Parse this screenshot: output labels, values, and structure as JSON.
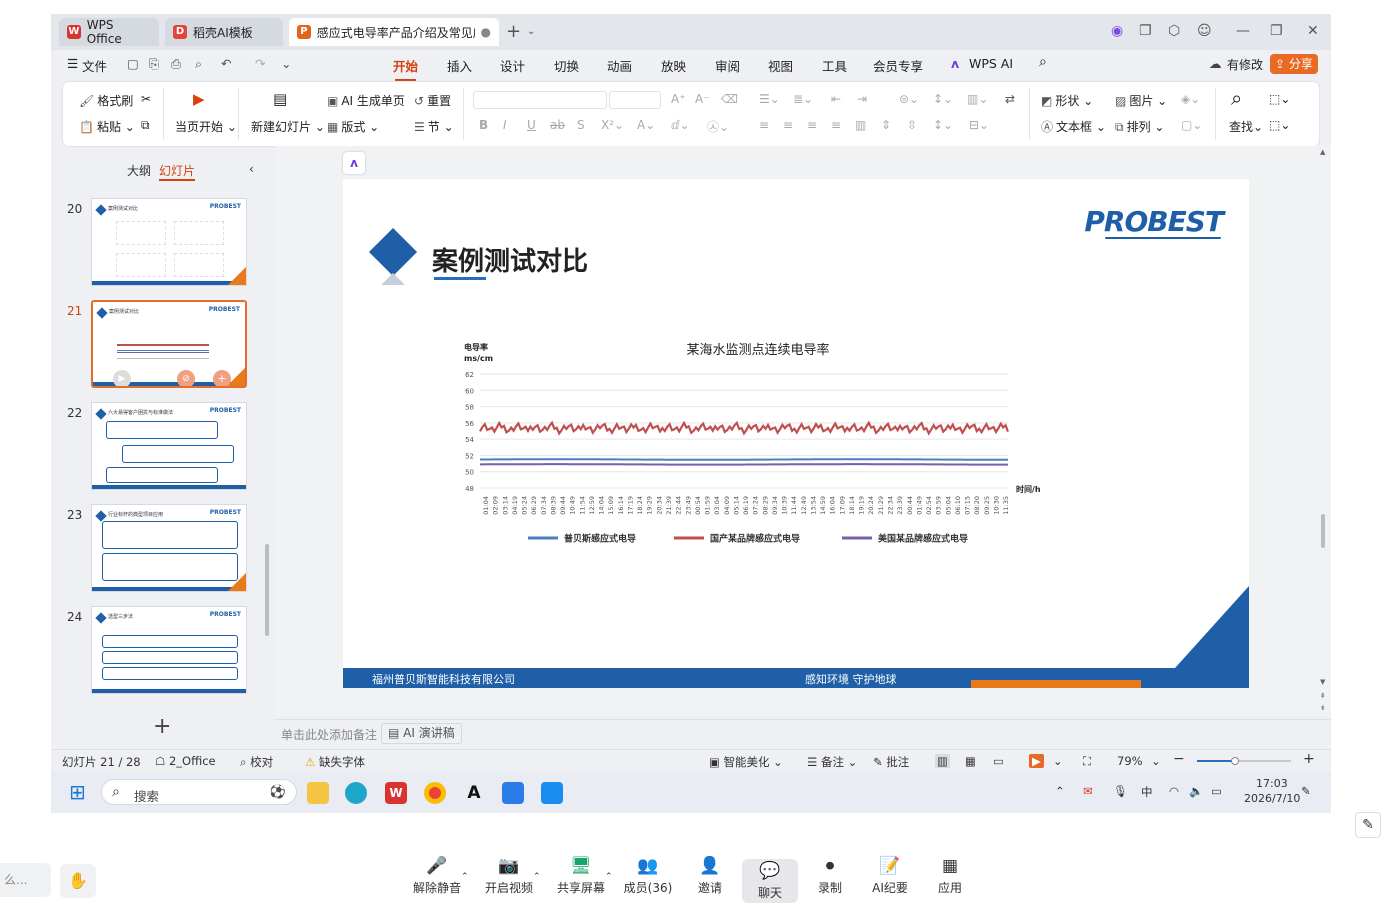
{
  "tabs": [
    {
      "label": "WPS Office"
    },
    {
      "label": "稻壳AI模板"
    },
    {
      "label": "感应式电导率产品介绍及常见应用"
    }
  ],
  "menu": {
    "file": "文件",
    "items": [
      "开始",
      "插入",
      "设计",
      "切换",
      "动画",
      "放映",
      "审阅",
      "视图",
      "工具",
      "会员专享",
      "WPS AI"
    ],
    "modify": "有修改",
    "share": "分享"
  },
  "ribbon": {
    "format_painter": "格式刷",
    "paste": "粘贴",
    "start_current": "当页开始",
    "new_slide": "新建幻灯片",
    "ai_generate": "AI 生成单页",
    "layout": "版式",
    "reset": "重置",
    "section": "节",
    "shape": "形状",
    "picture": "图片",
    "textbox": "文本框",
    "arrange": "排列",
    "find": "查找"
  },
  "left_panel": {
    "outline_tab": "大纲",
    "slides_tab": "幻灯片",
    "slides": [
      {
        "num": "20",
        "title": "案例测试对比"
      },
      {
        "num": "21",
        "title": "案例测试对比"
      },
      {
        "num": "22",
        "title": "六大易得客户困扰与标准做法"
      },
      {
        "num": "23",
        "title": "行业标杆的典型项目应用"
      },
      {
        "num": "24",
        "title": "选型三步法"
      }
    ]
  },
  "slide": {
    "title": "案例测试对比",
    "logo": "PROBEST",
    "footer_left": "福州普贝斯智能科技有限公司",
    "footer_right": "感知环境  守护地球"
  },
  "chart_data": {
    "type": "line",
    "title": "某海水监测点连续电导率",
    "ylabel": "电导率\nms/cm",
    "xlabel": "时间/h",
    "ylim": [
      48,
      62
    ],
    "yticks": [
      48,
      50,
      52,
      54,
      56,
      58,
      60,
      62
    ],
    "categories": [
      "01:04",
      "02:09",
      "03:14",
      "04:19",
      "05:24",
      "06:29",
      "07:34",
      "08:39",
      "09:44",
      "10:49",
      "11:54",
      "12:59",
      "14:04",
      "15:09",
      "16:14",
      "17:19",
      "18:24",
      "19:29",
      "20:34",
      "21:39",
      "22:44",
      "23:49",
      "00:54",
      "01:59",
      "03:04",
      "04:09",
      "05:14",
      "06:19",
      "07:24",
      "08:29",
      "09:34",
      "10:39",
      "11:44",
      "12:49",
      "13:54",
      "14:59",
      "16:04",
      "17:09",
      "18:14",
      "19:19",
      "20:24",
      "21:29",
      "22:34",
      "23:39",
      "00:44",
      "01:49",
      "02:54",
      "03:59",
      "05:04",
      "06:10",
      "07:15",
      "08:20",
      "09:25",
      "10:30",
      "11:35"
    ],
    "series": [
      {
        "name": "普贝斯感应式电导",
        "color": "#4a7fc1",
        "value": 51.5
      },
      {
        "name": "国产某品牌感应式电导",
        "color": "#c0504d",
        "value": 55.4
      },
      {
        "name": "美国某品牌感应式电导",
        "color": "#7b5ea7",
        "value": 50.9
      }
    ],
    "legend": "bottom"
  },
  "notes": {
    "placeholder": "单击此处添加备注",
    "ai_speech": "AI 演讲稿"
  },
  "status": {
    "slide_pos": "幻灯片 21 / 28",
    "theme": "2_Office",
    "proof": "校对",
    "missing_font": "缺失字体",
    "beautify": "智能美化",
    "notes": "备注",
    "comment": "批注",
    "zoom": "79%"
  },
  "taskbar": {
    "search": "搜索",
    "ime": "中",
    "time": "17:03",
    "date": "2026/7/10"
  },
  "meeting": {
    "left_text": "么...",
    "buttons": [
      "解除静音",
      "开启视频",
      "共享屏幕",
      "成员(36)",
      "邀请",
      "聊天",
      "录制",
      "AI纪要",
      "应用"
    ]
  }
}
